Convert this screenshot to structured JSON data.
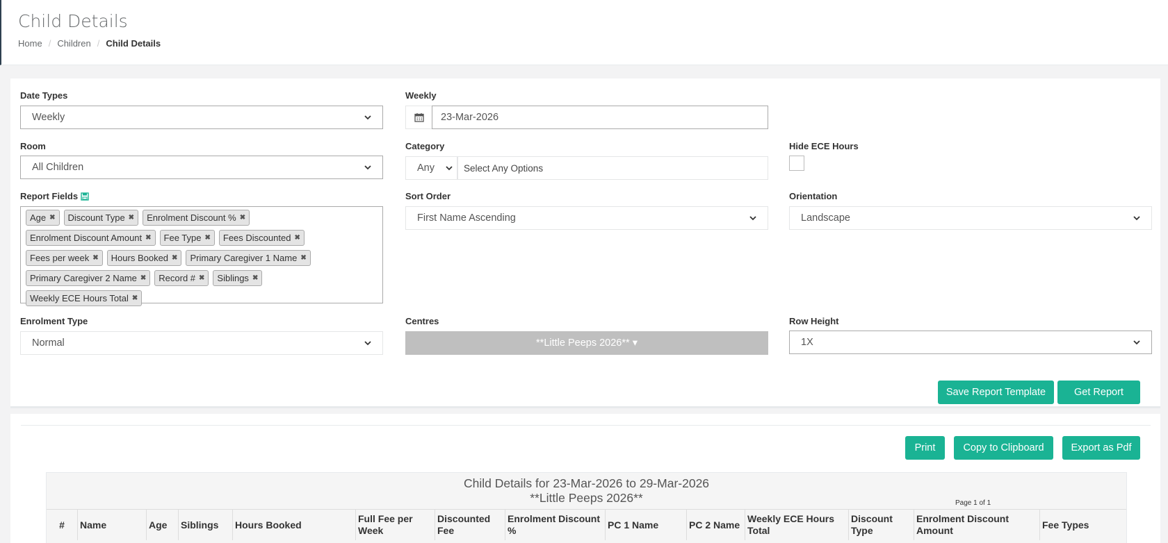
{
  "header": {
    "title": "Child Details",
    "breadcrumb": [
      "Home",
      "Children",
      "Child Details"
    ]
  },
  "form": {
    "date_types": {
      "label": "Date Types",
      "value": "Weekly"
    },
    "weekly": {
      "label": "Weekly",
      "value": "23-Mar-2026"
    },
    "room": {
      "label": "Room",
      "value": "All Children"
    },
    "category": {
      "label": "Category",
      "any_value": "Any",
      "placeholder": "Select Any Options"
    },
    "hide_ece": {
      "label": "Hide ECE Hours"
    },
    "report_fields": {
      "label": "Report Fields",
      "tags": [
        "Age",
        "Discount Type",
        "Enrolment Discount %",
        "Enrolment Discount Amount",
        "Fee Type",
        "Fees Discounted",
        "Fees per week",
        "Hours Booked",
        "Primary Caregiver 1 Name",
        "Primary Caregiver 2 Name",
        "Record #",
        "Siblings",
        "Weekly ECE Hours Total"
      ]
    },
    "sort_order": {
      "label": "Sort Order",
      "value": "First Name Ascending"
    },
    "orientation": {
      "label": "Orientation",
      "value": "Landscape"
    },
    "enrolment_type": {
      "label": "Enrolment Type",
      "value": "Normal"
    },
    "centres": {
      "label": "Centres",
      "value": "**Little Peeps 2026** ▾"
    },
    "row_height": {
      "label": "Row Height",
      "value": "1X"
    },
    "save_template_label": "Save Report Template",
    "get_report_label": "Get Report"
  },
  "report": {
    "print_label": "Print",
    "copy_label": "Copy to Clipboard",
    "export_label": "Export as Pdf",
    "title_line1": "Child Details for 23-Mar-2026 to 29-Mar-2026",
    "title_line2": "**Little Peeps 2026**",
    "page_info": "Page 1 of 1",
    "columns": [
      "#",
      "Name",
      "Age",
      "Siblings",
      "Hours Booked",
      "Full Fee per Week",
      "Discounted Fee",
      "Enrolment Discount %",
      "PC 1 Name",
      "PC 2 Name",
      "Weekly ECE Hours Total",
      "Discount Type",
      "Enrolment Discount Amount",
      "Fee Types"
    ]
  },
  "colors": {
    "accent": "#1ab394",
    "disabled": "#bfbfbf"
  }
}
